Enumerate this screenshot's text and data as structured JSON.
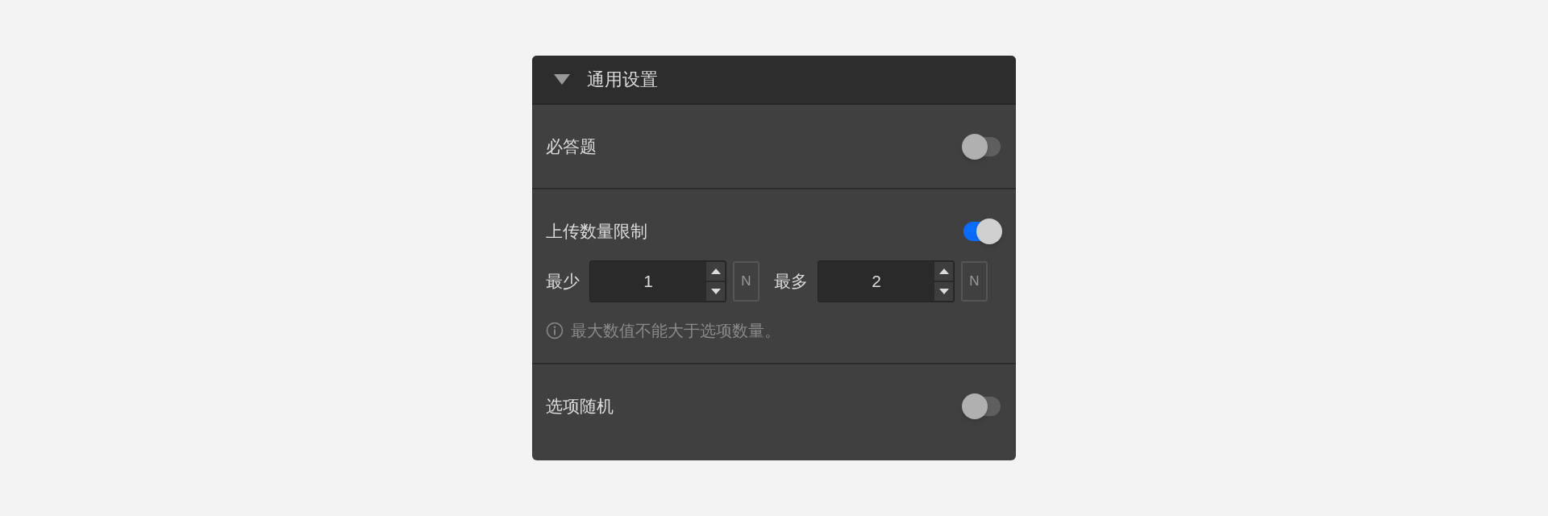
{
  "section": {
    "title": "通用设置",
    "expanded": true
  },
  "rows": [
    {
      "kind": "toggle",
      "label": "必答题",
      "on": false
    },
    {
      "kind": "limit",
      "label": "上传数量限制",
      "on": true,
      "fields": [
        {
          "label": "最少",
          "value": "1",
          "unit": "N"
        },
        {
          "label": "最多",
          "value": "2",
          "unit": "N"
        }
      ],
      "note": "最大数值不能大于选项数量。"
    },
    {
      "kind": "toggle",
      "label": "选项随机",
      "on": false
    }
  ]
}
